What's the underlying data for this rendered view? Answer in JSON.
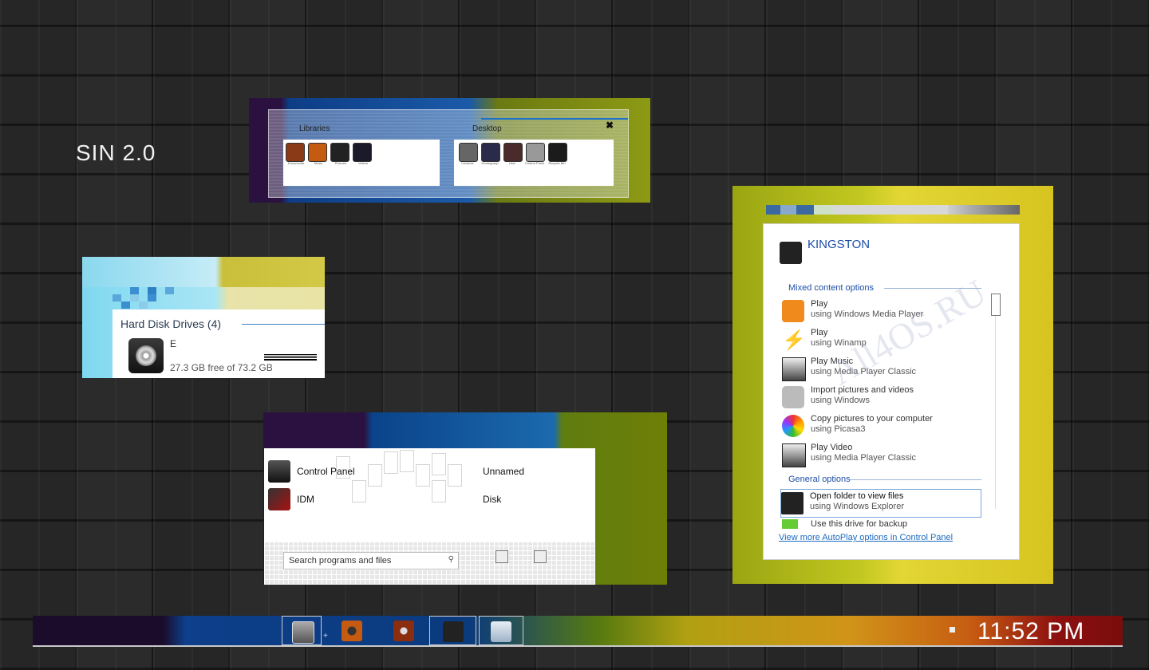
{
  "desktop": {
    "theme_title": "SIN 2.0",
    "watermark": "All4OS.RU"
  },
  "switcher": {
    "libraries_label": "Libraries",
    "desktop_label": "Desktop",
    "close_glyph": "✖",
    "library_items": [
      "Documents",
      "Music",
      "Pictures",
      "Videos"
    ],
    "desktop_items": [
      "Libraries",
      "Homegroup",
      "User",
      "Control Panel",
      "Recycle Bin"
    ]
  },
  "explorer": {
    "group_header": "Hard Disk Drives (4)",
    "drive_name": "E",
    "drive_free": "27.3 GB free of 73.2 GB",
    "drive_usage_fraction": 0.63
  },
  "start_menu": {
    "programs": [
      {
        "label": "Control Panel",
        "icon": "control-panel-icon"
      },
      {
        "label": "IDM",
        "icon": "idm-icon"
      }
    ],
    "right_items": [
      "Unnamed",
      "Disk"
    ],
    "search_placeholder": "Search programs and files"
  },
  "autoplay": {
    "device": "KINGSTON",
    "mixed_header": "Mixed content options",
    "options": [
      {
        "line1": "Play",
        "line2": "using Windows Media Player",
        "icon": "wmp-icon"
      },
      {
        "line1": "Play",
        "line2": "using Winamp",
        "icon": "winamp-icon"
      },
      {
        "line1": "Play Music",
        "line2": "using Media Player Classic",
        "icon": "mpc-icon"
      },
      {
        "line1": "Import pictures and videos",
        "line2": "using Windows",
        "icon": "camera-icon"
      },
      {
        "line1": "Copy pictures to your computer",
        "line2": "using Picasa3",
        "icon": "picasa-icon"
      },
      {
        "line1": "Play Video",
        "line2": "using Media Player Classic",
        "icon": "mpc-icon"
      }
    ],
    "general_header": "General options",
    "general": [
      {
        "line1": "Open folder to view files",
        "line2": "using Windows Explorer",
        "icon": "folder-icon"
      },
      {
        "line1": "Use this drive for backup",
        "line2": "",
        "icon": "backup-icon"
      }
    ],
    "link": "View more AutoPlay options in Control Panel"
  },
  "taskbar": {
    "buttons": [
      "start-orb-icon",
      "media-player-icon",
      "winamp-icon",
      "windows-media-icon",
      "notepad-icon"
    ],
    "clock": "11:52 PM"
  }
}
